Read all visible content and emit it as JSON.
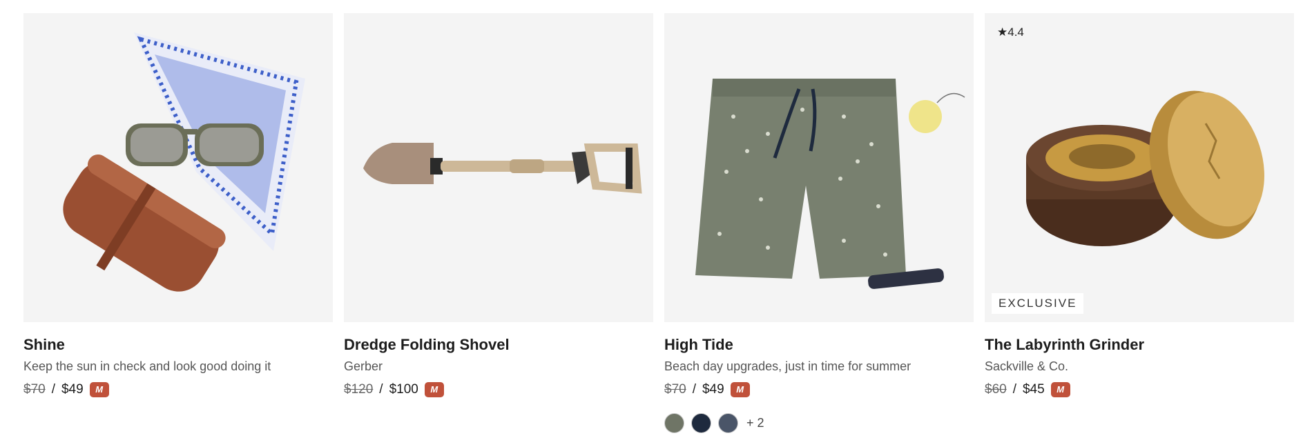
{
  "products": [
    {
      "title": "Shine",
      "subtitle": "Keep the sun in check and look good doing it",
      "price_original": "$70",
      "price_separator": "/",
      "price_sale": "$49",
      "member_icon": "M"
    },
    {
      "title": "Dredge Folding Shovel",
      "subtitle": "Gerber",
      "price_original": "$120",
      "price_separator": "/",
      "price_sale": "$100",
      "member_icon": "M"
    },
    {
      "title": "High Tide",
      "subtitle": "Beach day upgrades, just in time for summer",
      "price_original": "$70",
      "price_separator": "/",
      "price_sale": "$49",
      "member_icon": "M",
      "more_colors": "+ 2",
      "swatch_colors": [
        "#6f7566",
        "#1e2a3e",
        "#4a5568"
      ]
    },
    {
      "title": "The Labyrinth Grinder",
      "subtitle": "Sackville & Co.",
      "rating": "★4.4",
      "badge": "EXCLUSIVE",
      "price_original": "$60",
      "price_separator": "/",
      "price_sale": "$45",
      "member_icon": "M"
    }
  ],
  "colors": {
    "member_badge": "#c0513a",
    "image_bg": "#f4f4f4"
  }
}
